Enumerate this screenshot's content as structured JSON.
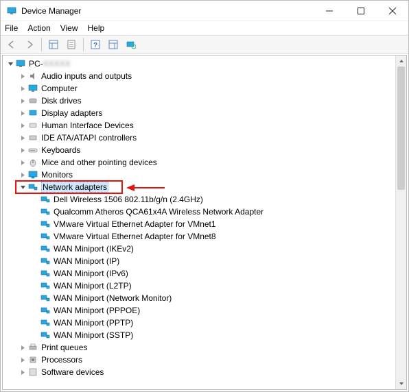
{
  "window": {
    "title": "Device Manager"
  },
  "menu": {
    "file": "File",
    "action": "Action",
    "view": "View",
    "help": "Help"
  },
  "tree": {
    "root": "PC-",
    "categories": {
      "audio": "Audio inputs and outputs",
      "computer": "Computer",
      "disk": "Disk drives",
      "display": "Display adapters",
      "hid": "Human Interface Devices",
      "ide": "IDE ATA/ATAPI controllers",
      "keyboards": "Keyboards",
      "mice": "Mice and other pointing devices",
      "monitors": "Monitors",
      "network": "Network adapters",
      "print": "Print queues",
      "processors": "Processors",
      "software": "Software devices"
    },
    "network_items": [
      "Dell Wireless 1506 802.11b/g/n (2.4GHz)",
      "Qualcomm Atheros QCA61x4A Wireless Network Adapter",
      "VMware Virtual Ethernet Adapter for VMnet1",
      "VMware Virtual Ethernet Adapter for VMnet8",
      "WAN Miniport (IKEv2)",
      "WAN Miniport (IP)",
      "WAN Miniport (IPv6)",
      "WAN Miniport (L2TP)",
      "WAN Miniport (Network Monitor)",
      "WAN Miniport (PPPOE)",
      "WAN Miniport (PPTP)",
      "WAN Miniport (SSTP)"
    ]
  }
}
